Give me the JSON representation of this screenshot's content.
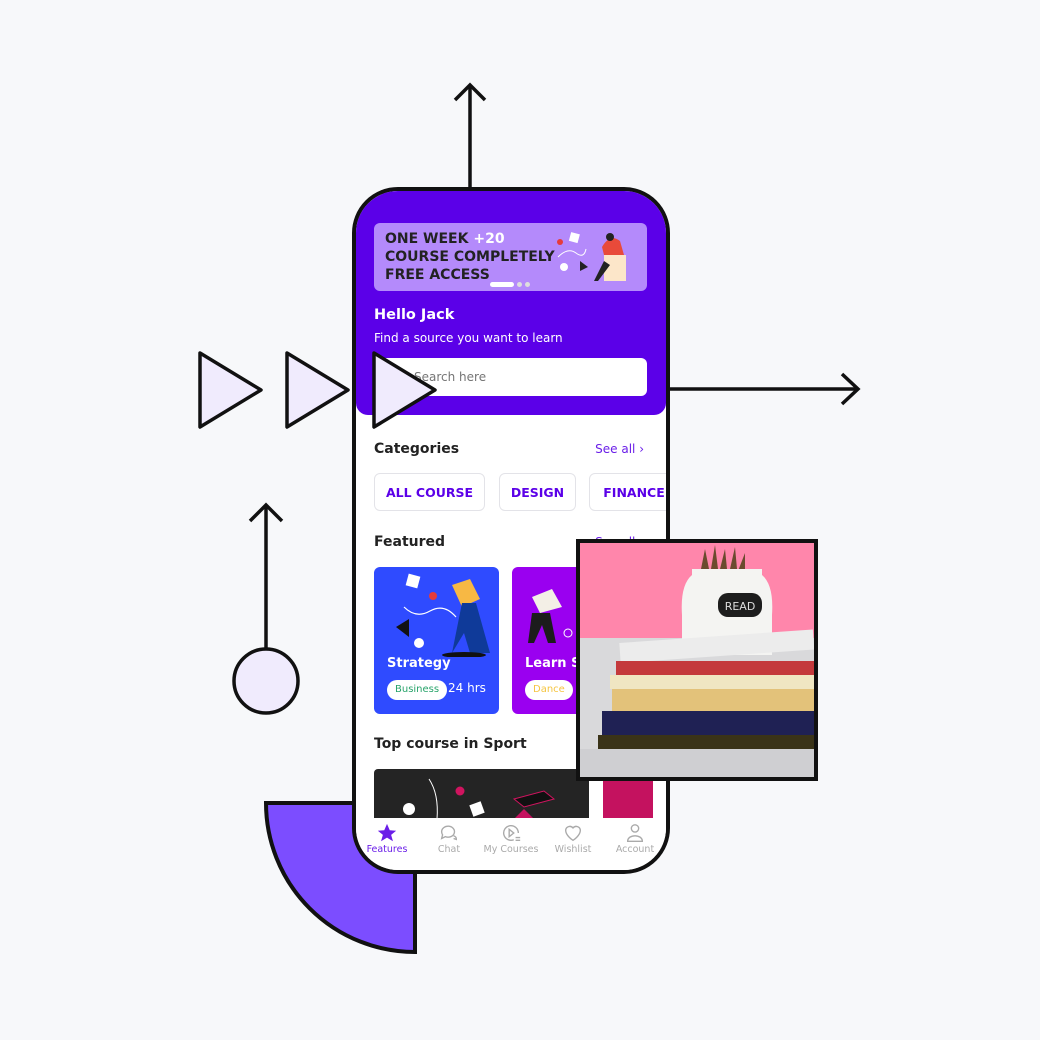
{
  "banner": {
    "line1": "ONE WEEK ",
    "line1_accent": "+20",
    "line2": "COURSE COMPLETELY",
    "line3": "FREE ACCESS",
    "slide_count": 3,
    "active_slide": 1
  },
  "greeting": {
    "title": "Hello Jack",
    "subtitle": "Find a source you want to learn"
  },
  "search": {
    "placeholder": "Search here"
  },
  "categories": {
    "title": "Categories",
    "see_all": "See all",
    "items": [
      "ALL COURSE",
      "DESIGN",
      "FINANCE"
    ]
  },
  "featured": {
    "title": "Featured",
    "see_all": "See all",
    "cards": [
      {
        "title": "Strategy",
        "tag": "Business",
        "duration": "24 hrs",
        "color": "#2f4bff",
        "tag_color": "#27a36a"
      },
      {
        "title": "Learn Salsa",
        "tag": "Dance",
        "color": "#9a00f0",
        "tag_color": "#f5c542"
      }
    ]
  },
  "top_course": {
    "title": "Top course in Sport"
  },
  "nav": {
    "items": [
      {
        "label": "Features",
        "icon": "star-icon",
        "active": true
      },
      {
        "label": "Chat",
        "icon": "chat-icon"
      },
      {
        "label": "My Courses",
        "icon": "play-list-icon"
      },
      {
        "label": "Wishlist",
        "icon": "heart-icon"
      },
      {
        "label": "Account",
        "icon": "user-icon"
      }
    ]
  },
  "photo": {
    "jar_label": "READ"
  },
  "colors": {
    "primary": "#5b00e8",
    "accent": "#7c4dff",
    "triangle_fill": "#f0ebfd"
  }
}
